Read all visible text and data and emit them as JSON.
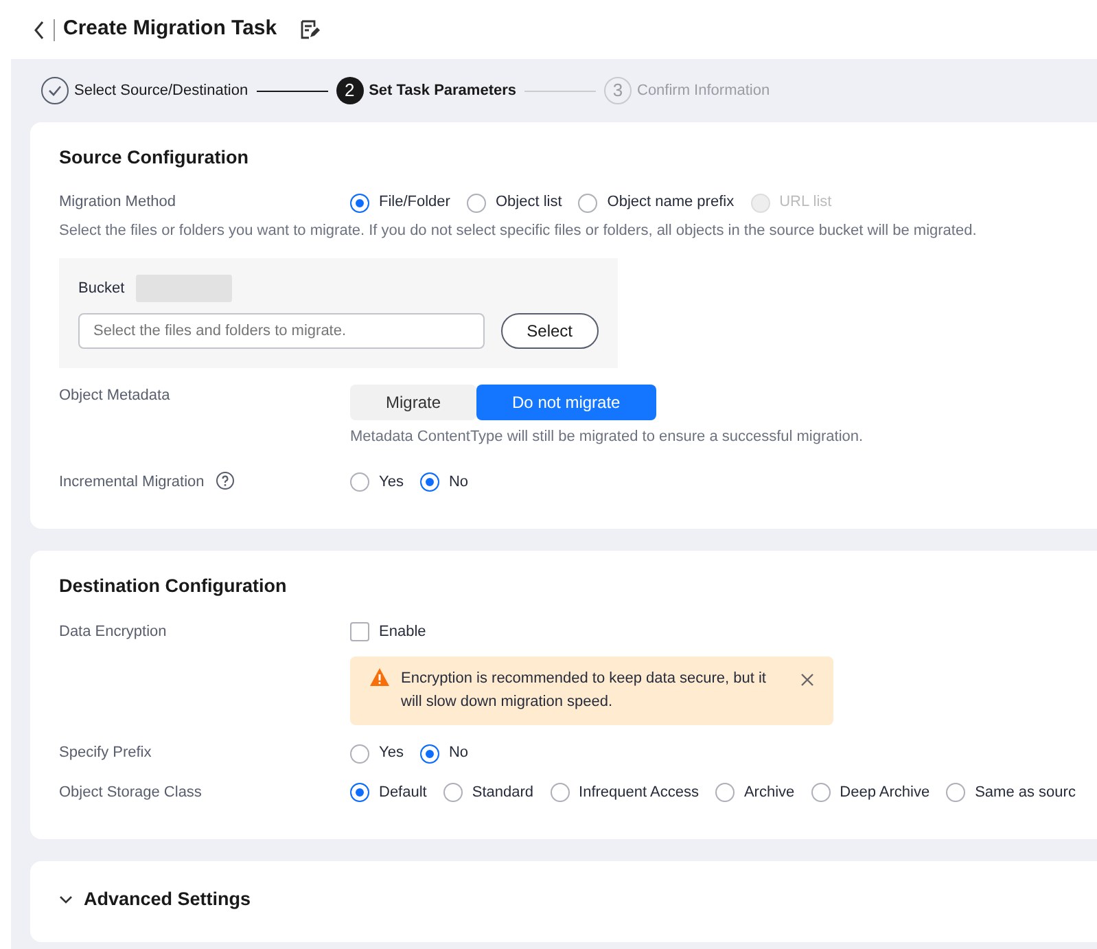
{
  "header": {
    "title": "Create Migration Task"
  },
  "steps": [
    {
      "kind": "done",
      "label": "Select Source/Destination"
    },
    {
      "kind": "current",
      "number": "2",
      "label": "Set Task Parameters"
    },
    {
      "kind": "pending",
      "number": "3",
      "label": "Confirm Information"
    }
  ],
  "sections": [
    {
      "kind": "form",
      "title": "Source Configuration",
      "fields": [
        {
          "kind": "radio",
          "label": "Migration Method",
          "options": [
            {
              "label": "File/Folder",
              "selected": true,
              "disabled": false
            },
            {
              "label": "Object list",
              "selected": false,
              "disabled": false
            },
            {
              "label": "Object name prefix",
              "selected": false,
              "disabled": false
            },
            {
              "label": "URL list",
              "selected": false,
              "disabled": true
            }
          ],
          "hint": "Select the files or folders you want to migrate. If you do not select specific files or folders, all objects in the source bucket will be migrated."
        },
        {
          "kind": "bucket",
          "label": "Bucket",
          "placeholder": "Select the files and folders to migrate.",
          "button": "Select"
        },
        {
          "kind": "segmented",
          "label": "Object Metadata",
          "options": [
            {
              "label": "Migrate",
              "selected": false
            },
            {
              "label": "Do not migrate",
              "selected": true
            }
          ],
          "note": "Metadata ContentType will still be migrated to ensure a successful migration."
        },
        {
          "kind": "radio",
          "label": "Incremental Migration",
          "help": true,
          "options": [
            {
              "label": "Yes",
              "selected": false
            },
            {
              "label": "No",
              "selected": true
            }
          ]
        }
      ]
    },
    {
      "kind": "form",
      "title": "Destination Configuration",
      "fields": [
        {
          "kind": "checkbox",
          "label": "Data Encryption",
          "option": {
            "label": "Enable",
            "checked": false
          },
          "alert": "Encryption is recommended to keep data secure, but it will slow down migration speed."
        },
        {
          "kind": "radio",
          "label": "Specify Prefix",
          "options": [
            {
              "label": "Yes",
              "selected": false
            },
            {
              "label": "No",
              "selected": true
            }
          ]
        },
        {
          "kind": "radio",
          "label": "Object Storage Class",
          "options": [
            {
              "label": "Default",
              "selected": true
            },
            {
              "label": "Standard",
              "selected": false
            },
            {
              "label": "Infrequent Access",
              "selected": false
            },
            {
              "label": "Archive",
              "selected": false
            },
            {
              "label": "Deep Archive",
              "selected": false
            },
            {
              "label": "Same as sourc",
              "selected": false
            }
          ]
        }
      ]
    },
    {
      "kind": "collapsible",
      "title": "Advanced Settings",
      "expanded": false
    }
  ]
}
